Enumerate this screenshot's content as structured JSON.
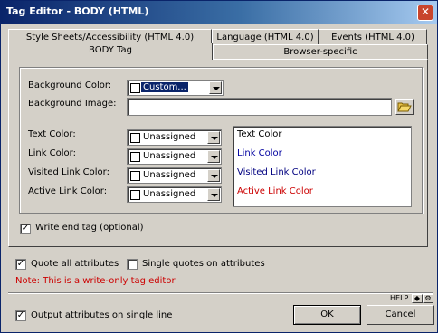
{
  "window": {
    "title": "Tag Editor - BODY (HTML)",
    "close_glyph": "✕"
  },
  "tabs": {
    "row1": [
      "Style Sheets/Accessibility (HTML 4.0)",
      "Language (HTML 4.0)",
      "Events (HTML 4.0)"
    ],
    "row2": [
      "BODY Tag",
      "Browser-specific"
    ]
  },
  "body_tag": {
    "background_color_label": "Background Color:",
    "background_color_value": "Custom...",
    "background_image_label": "Background Image:",
    "background_image_value": "",
    "text_color_label": "Text Color:",
    "link_color_label": "Link Color:",
    "visited_link_color_label": "Visited Link Color:",
    "active_link_color_label": "Active Link Color:",
    "unassigned": "Unassigned",
    "sample": {
      "text": "Text Color",
      "link": "Link Color",
      "visited": "Visited Link Color",
      "active": "Active Link Color"
    },
    "write_end_tag_label": "Write end tag (optional)"
  },
  "colors": {
    "link": "#0000a0",
    "visited": "#000080",
    "active": "#cc0000",
    "note": "#cc0000",
    "title_bar": "#0a246a"
  },
  "options": {
    "quote_all_label": "Quote all attributes",
    "single_quotes_label": "Single quotes on attributes",
    "note": "Note: This is a write-only tag editor",
    "output_single_line_label": "Output attributes on single line"
  },
  "footer": {
    "help_label": "HELP",
    "ok_label": "OK",
    "cancel_label": "Cancel"
  },
  "icons": {
    "close": "close-icon",
    "folder": "open-folder-icon",
    "checked": "check-icon"
  }
}
